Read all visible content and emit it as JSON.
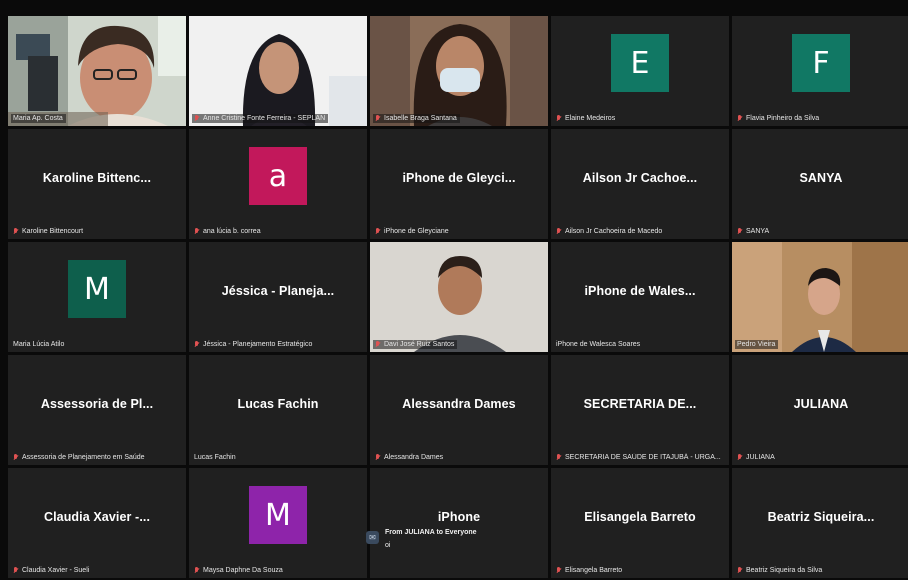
{
  "colors": {
    "background": "#0a0a0a",
    "tile": "#202020",
    "active_speaker_border": "#b9c97a",
    "muted_icon": "#e05252"
  },
  "participants": [
    {
      "type": "video",
      "scene": "woman-glasses-office",
      "label": "Maria Ap. Costa",
      "muted": false,
      "active": true
    },
    {
      "type": "video",
      "scene": "woman-long-hair",
      "label": "Anne Cristine Fonte Ferreira - SEPLAN",
      "muted": true
    },
    {
      "type": "video",
      "scene": "woman-mask",
      "label": "Isabelle Braga Santana",
      "muted": true
    },
    {
      "type": "avatar",
      "letter": "E",
      "color": "#117864",
      "label": "Elaine Medeiros",
      "muted": true
    },
    {
      "type": "avatar",
      "letter": "F",
      "color": "#117864",
      "label": "Flavia Pinheiro da Silva",
      "muted": true
    },
    {
      "type": "name",
      "display": "Karoline Bittenc...",
      "label": "Karoline Bittencourt",
      "muted": true
    },
    {
      "type": "avatar",
      "letter": "a",
      "color": "#c2185b",
      "label": "ana lúcia b. correa",
      "muted": true
    },
    {
      "type": "name",
      "display": "iPhone de Gleyci...",
      "label": "iPhone de Gleyciane",
      "muted": true
    },
    {
      "type": "name",
      "display": "Ailson Jr Cachoe...",
      "label": "Ailson Jr Cachoeira de Macedo",
      "muted": true
    },
    {
      "type": "name",
      "display": "SANYA",
      "label": "SANYA",
      "muted": true
    },
    {
      "type": "avatar",
      "letter": "M",
      "color": "#0e5f4c",
      "label": "Maria Lúcia Atilo",
      "muted": false
    },
    {
      "type": "name",
      "display": "Jéssica - Planeja...",
      "label": "Jéssica - Planejamento Estratégico",
      "muted": true
    },
    {
      "type": "video",
      "scene": "man-white-wall",
      "label": "Davi José Ruiz Santos",
      "muted": true
    },
    {
      "type": "name",
      "display": "iPhone de Wales...",
      "label": "iPhone de Walesca Soares",
      "muted": false
    },
    {
      "type": "video",
      "scene": "man-wood-room",
      "label": "Pedro Vieira",
      "muted": false
    },
    {
      "type": "name",
      "display": "Assessoria de Pl...",
      "label": "Assessoria de Planejamento em Saúde",
      "muted": true
    },
    {
      "type": "name",
      "display": "Lucas Fachin",
      "label": "Lucas Fachin",
      "muted": false
    },
    {
      "type": "name",
      "display": "Alessandra Dames",
      "label": "Alessandra Dames",
      "muted": true
    },
    {
      "type": "name",
      "display": "SECRETARIA DE...",
      "label": "SECRETARIA DE SAÚDE DE ITAJUBÁ - URGA...",
      "muted": true
    },
    {
      "type": "name",
      "display": "JULIANA",
      "label": "JULIANA",
      "muted": true
    },
    {
      "type": "name",
      "display": "Claudia Xavier -...",
      "label": "Claudia Xavier - Sueli",
      "muted": true
    },
    {
      "type": "avatar",
      "letter": "M",
      "color": "#8e24aa",
      "label": "Maysa Daphne Da Souza",
      "muted": true
    },
    {
      "type": "name",
      "display": "iPhone",
      "label": "",
      "muted": false
    },
    {
      "type": "name",
      "display": "Elisangela Barreto",
      "label": "Elisangela Barreto",
      "muted": true
    },
    {
      "type": "name",
      "display": "Beatriz Siqueira...",
      "label": "Beatriz Siqueira da Silva",
      "muted": true
    }
  ],
  "chat_popup": {
    "icon": "chat-bubble-icon",
    "from": "From JULIANA to Everyone",
    "message": "oi"
  }
}
